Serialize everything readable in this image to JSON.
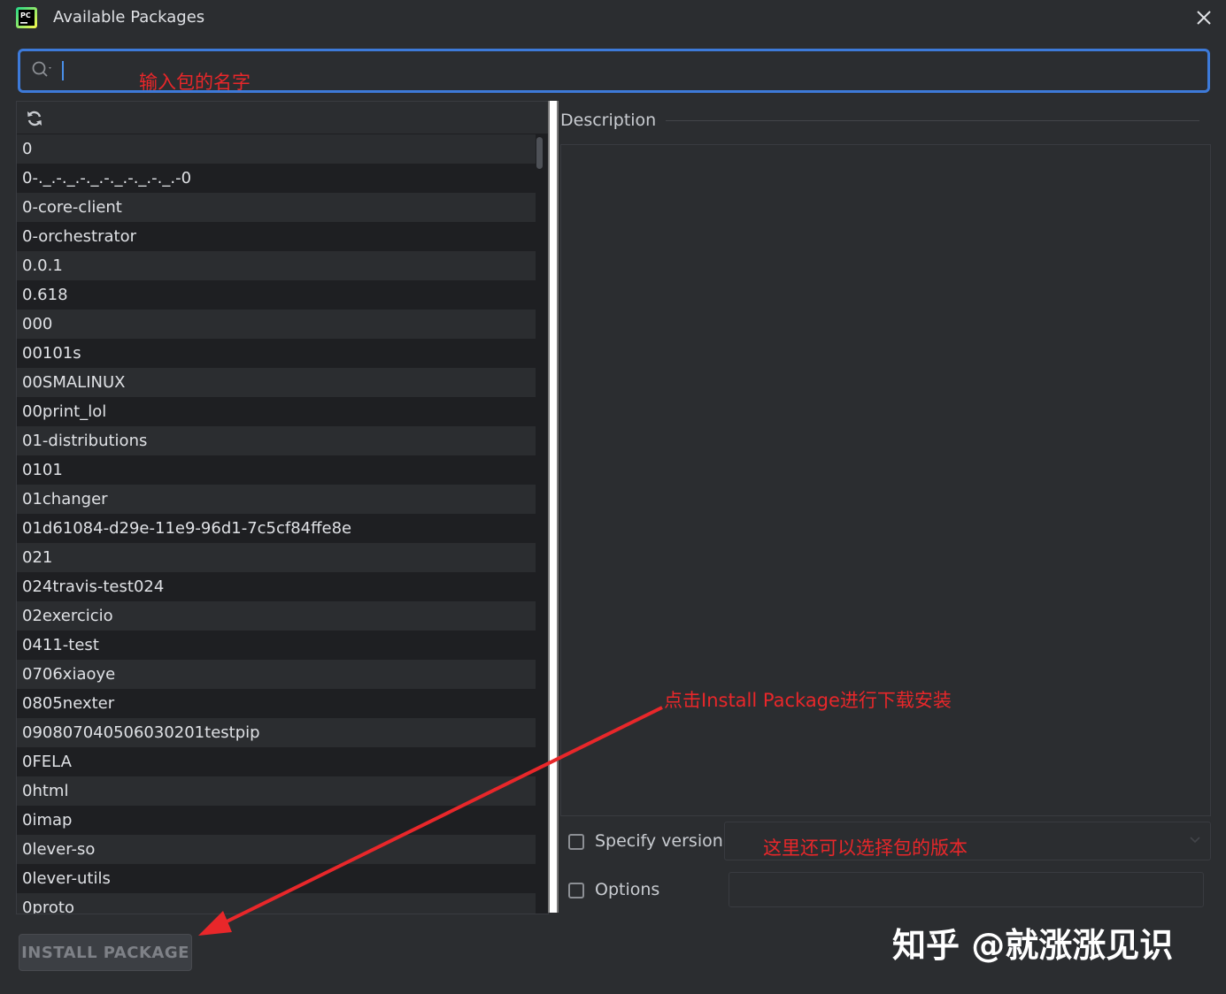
{
  "window": {
    "title": "Available Packages",
    "app_icon_text": "PC"
  },
  "search": {
    "value": "",
    "placeholder": ""
  },
  "annotations": {
    "search_hint": "输入包的名字",
    "install_hint": "点击Install Package进行下载安装",
    "version_hint": "这里还可以选择包的版本"
  },
  "packages": [
    "0",
    "0-._.-._.-._.-._.-._.-._.-0",
    "0-core-client",
    "0-orchestrator",
    "0.0.1",
    "0.618",
    "000",
    "00101s",
    "00SMALINUX",
    "00print_lol",
    "01-distributions",
    "0101",
    "01changer",
    "01d61084-d29e-11e9-96d1-7c5cf84ffe8e",
    "021",
    "024travis-test024",
    "02exercicio",
    "0411-test",
    "0706xiaoye",
    "0805nexter",
    "0908070405060302​01testpip",
    "0FELA",
    "0html",
    "0imap",
    "0lever-so",
    "0lever-utils",
    "0proto"
  ],
  "details": {
    "description_label": "Description"
  },
  "options": {
    "specify_version_label": "Specify version",
    "options_label": "Options",
    "options_value": ""
  },
  "actions": {
    "install_label": "INSTALL PACKAGE"
  },
  "watermark": "知乎 @就涨涨见识",
  "colors": {
    "accent": "#3d7ad9",
    "annotation": "#e8272a",
    "background": "#2b2d30",
    "list_bg": "#1e1f22"
  }
}
